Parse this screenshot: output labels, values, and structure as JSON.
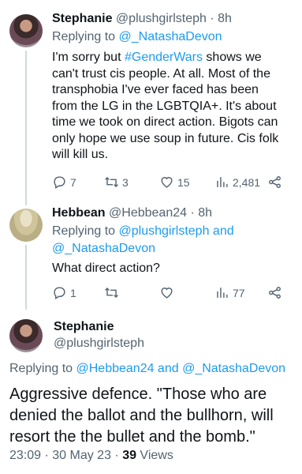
{
  "tweet1": {
    "name": "Stephanie",
    "handle": "@plushgirlsteph",
    "time": "· 8h",
    "replying_prefix": "Replying to",
    "replying_to": "@_NatashaDevon",
    "line1_pre": "I'm sorry but ",
    "hashtag": "#GenderWars",
    "line1_post": " shows we",
    "line2": "can't trust cis people. At all. Most of the",
    "line3": "transphobia I've ever faced has been",
    "line4": "from the LG in the LGBTQIA+. It's about",
    "line5": "time we took on direct action. Bigots can",
    "line6": "only hope we use soup in future. Cis folk",
    "line7": "will kill us.",
    "replies": "7",
    "retweets": "3",
    "likes": "15",
    "views": "2,481"
  },
  "tweet2": {
    "name": "Hebbean",
    "handle": "@Hebbean24",
    "time": "· 8h",
    "replying_prefix": "Replying to",
    "replying_to_1": "@plushgirlsteph",
    "and": " and",
    "replying_to_2": "@_NatashaDevon",
    "text": "What direct action?",
    "replies": "1",
    "retweets": "",
    "likes": "",
    "views": "77"
  },
  "tweet3": {
    "name": "Stephanie",
    "handle": "@plushgirlsteph",
    "replying_prefix": "Replying to",
    "replying_to_1": "@Hebbean24",
    "and": " and",
    "replying_to_2": "@_NatashaDevon",
    "line1": "Aggressive defence. \"Those who are",
    "line2": "denied the ballot and the bullhorn, will",
    "line3": "resort the the bullet and the bomb.\"",
    "timestamp": "23:09 · 30 May 23 · ",
    "views_count": "39",
    "views_label": " Views"
  },
  "icons": [
    "reply-icon",
    "retweet-icon",
    "like-icon",
    "views-icon",
    "share-icon"
  ],
  "colors": {
    "link": "#1d9bf0",
    "muted": "#536471",
    "text": "#0f1419"
  }
}
